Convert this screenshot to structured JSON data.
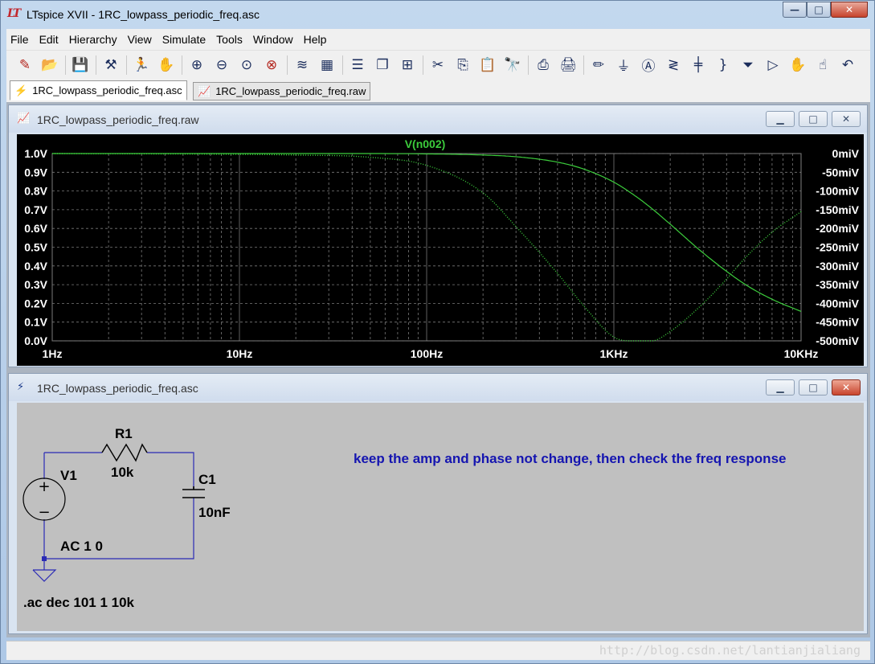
{
  "app": {
    "title": "LTspice XVII - 1RC_lowpass_periodic_freq.asc",
    "logo": "LT"
  },
  "window_controls": {
    "minimize": "—",
    "maximize": "□",
    "close": "✕"
  },
  "menu": [
    "File",
    "Edit",
    "Hierarchy",
    "View",
    "Simulate",
    "Tools",
    "Window",
    "Help"
  ],
  "toolbar_icons": [
    "new-schematic-icon",
    "open-icon",
    "save-icon",
    "control-panel-icon",
    "run-icon",
    "halt-icon",
    "zoom-in-icon",
    "zoom-out-icon",
    "zoom-fit-icon",
    "zoom-cancel-icon",
    "autorange-icon",
    "plot-settings-icon",
    "tile-horizontal-icon",
    "cascade-icon",
    "tile-vertical-icon",
    "cut-icon",
    "copy-icon",
    "paste-icon",
    "find-icon",
    "print-icon",
    "print-setup-icon",
    "draw-wire-icon",
    "ground-icon",
    "label-net-icon",
    "resistor-icon",
    "capacitor-icon",
    "inductor-icon",
    "diode-icon",
    "component-icon",
    "move-icon",
    "drag-icon",
    "undo-icon"
  ],
  "tabs": [
    {
      "label": "1RC_lowpass_periodic_freq.asc",
      "icon": "schematic-icon",
      "active": true
    },
    {
      "label": "1RC_lowpass_periodic_freq.raw",
      "icon": "waveform-icon",
      "active": false
    }
  ],
  "waveform_window": {
    "title": "1RC_lowpass_periodic_freq.raw",
    "chart_data": {
      "type": "line",
      "title": "V(n002)",
      "xscale": "log",
      "xlim": [
        1,
        10000
      ],
      "x_ticks": [
        "1Hz",
        "10Hz",
        "100Hz",
        "1KHz",
        "10KHz"
      ],
      "y_left_ticks": [
        "1.0V",
        "0.9V",
        "0.8V",
        "0.7V",
        "0.6V",
        "0.5V",
        "0.4V",
        "0.3V",
        "0.2V",
        "0.1V",
        "0.0V"
      ],
      "y_right_ticks": [
        "0miV",
        "-50miV",
        "-100miV",
        "-150miV",
        "-200miV",
        "-250miV",
        "-300miV",
        "-350miV",
        "-400miV",
        "-450miV",
        "-500miV"
      ],
      "ylim_left": [
        0,
        1
      ],
      "grid": true,
      "trace_color": "#3ccc3c",
      "series": [
        {
          "name": "V(n002)",
          "style": "solid",
          "x": [
            1,
            10,
            100,
            200,
            300,
            500,
            700,
            1000,
            1300,
            1592,
            2000,
            3000,
            5000,
            7000,
            10000
          ],
          "y": [
            1.0,
            1.0,
            0.998,
            0.992,
            0.983,
            0.954,
            0.915,
            0.847,
            0.774,
            0.707,
            0.623,
            0.469,
            0.303,
            0.222,
            0.157
          ]
        },
        {
          "name": "phase",
          "style": "dotted",
          "x": [
            1,
            10,
            20,
            50,
            100,
            200,
            300,
            500,
            700,
            1000,
            1300,
            1592,
            2000,
            3000,
            4000,
            5000,
            7000,
            10000
          ],
          "y": [
            1.0,
            0.996,
            0.992,
            0.98,
            0.937,
            0.79,
            0.61,
            0.36,
            0.18,
            0.02,
            0.0,
            0.0,
            0.05,
            0.2,
            0.33,
            0.44,
            0.58,
            0.69
          ]
        }
      ]
    }
  },
  "schematic_window": {
    "title": "1RC_lowpass_periodic_freq.asc",
    "components": {
      "r1_name": "R1",
      "r1_value": "10k",
      "c1_name": "C1",
      "c1_value": "10nF",
      "v1_name": "V1",
      "v1_value": "AC 1 0"
    },
    "directive": ".ac dec 101 1 10k",
    "comment": "keep the amp and phase not change, then check the freq response"
  },
  "status": {
    "watermark": "http://blog.csdn.net/lantianjialiang"
  }
}
